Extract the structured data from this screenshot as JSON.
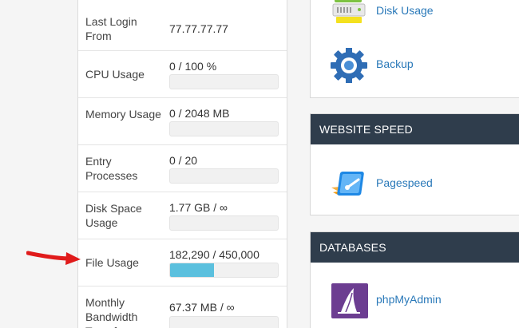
{
  "stats": [
    {
      "label": "Last Login From",
      "value": "77.77.77.77"
    },
    {
      "label": "CPU Usage",
      "value": "0 / 100 %",
      "fill": 0
    },
    {
      "label": "Memory Usage",
      "value": "0 / 2048 MB",
      "fill": 0
    },
    {
      "label": "Entry Processes",
      "value": "0 / 20",
      "fill": 0
    },
    {
      "label": "Disk Space Usage",
      "value": "1.77 GB / ∞",
      "fill": 0
    },
    {
      "label": "File Usage",
      "value": "182,290 / 450,000",
      "fill": 0.405
    },
    {
      "label": "Monthly Bandwidth Transfer",
      "value": "67.37 MB / ∞",
      "fill": 0
    }
  ],
  "files_panel": {
    "items": [
      {
        "label": "Disk Usage",
        "icon": "disk-usage-icon"
      },
      {
        "label": "Backup",
        "icon": "backup-gear-icon"
      }
    ]
  },
  "website_speed": {
    "title": "WEBSITE SPEED",
    "items": [
      {
        "label": "Pagespeed",
        "icon": "pagespeed-icon"
      }
    ]
  },
  "databases": {
    "title": "DATABASES",
    "items": [
      {
        "label": "phpMyAdmin",
        "icon": "phpmyadmin-icon"
      }
    ]
  },
  "colors": {
    "bar_fill": "#5bc0de",
    "panel_header": "#2f3d4c",
    "link": "#2a79b9",
    "arrow": "#e01b1b"
  }
}
